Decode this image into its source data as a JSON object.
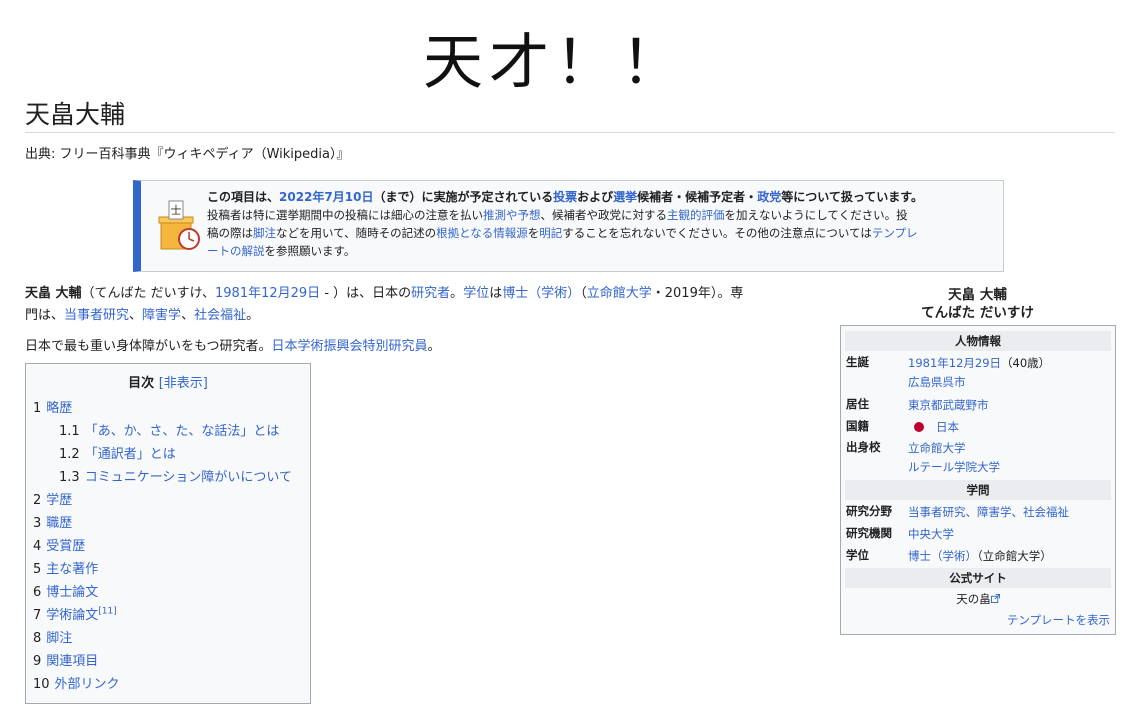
{
  "banner": "天才！！",
  "title": "天畠大輔",
  "from": "出典: フリー百科事典『ウィキペディア（Wikipedia）』",
  "notice": {
    "head_a": "この項目は、",
    "head_date": "2022年7月10日",
    "head_b": "（まで）に実施が予定されている",
    "head_vote": "投票",
    "head_c": "および",
    "head_elect": "選挙",
    "head_d": "候補者・候補予定者・",
    "head_party": "政党",
    "head_e": "等について扱っています。",
    "line1a": "投稿者は特に選挙期間中の投稿には細心の注意を払い",
    "line1_l1": "推測や予想",
    "line1b": "、候補者や政党に対する",
    "line1_l2": "主観的評価",
    "line1c": "を加えないようにしてください。投",
    "line2a": "稿の際は",
    "line2_l1": "脚注",
    "line2b": "などを用いて、随時その記述の",
    "line2_l2": "根拠となる情報源",
    "line2c": "を",
    "line2_l3": "明記",
    "line2d": "することを忘れないでください。その他の注意点については",
    "line2_l4": "テンプレ",
    "line3_l1": "ートの解説",
    "line3a": "を参照願います。"
  },
  "lead": {
    "name": "天畠 大輔",
    "a": "（てんばた だいすけ、",
    "birth": "1981年12月29日",
    "b": " - ）は、日本の",
    "researcher": "研究者",
    "c": "。",
    "degree": "学位",
    "d": "は",
    "phd": "博士（学術）",
    "e": "（",
    "uni": "立命館大学",
    "f": "・2019年）。専",
    "g": "門は、",
    "f1": "当事者研究",
    "h": "、",
    "f2": "障害学",
    "i": "、",
    "f3": "社会福祉",
    "j": "。"
  },
  "lead2": {
    "a": "日本で最も重い身体障がいをもつ研究者。",
    "jsps": "日本学術振興会特別研究員",
    "b": "。"
  },
  "toc": {
    "title": "目次",
    "hide": "[非表示]",
    "items": [
      {
        "num": "1",
        "label": "略歴"
      },
      {
        "num": "1.1",
        "label": "「あ、か、さ、た、な話法」とは"
      },
      {
        "num": "1.2",
        "label": "「通訳者」とは"
      },
      {
        "num": "1.3",
        "label": "コミュニケーション障がいについて"
      },
      {
        "num": "2",
        "label": "学歴"
      },
      {
        "num": "3",
        "label": "職歴"
      },
      {
        "num": "4",
        "label": "受賞歴"
      },
      {
        "num": "5",
        "label": "主な著作"
      },
      {
        "num": "6",
        "label": "博士論文"
      },
      {
        "num": "7",
        "label": "学術論文",
        "sup": "[11]"
      },
      {
        "num": "8",
        "label": "脚注"
      },
      {
        "num": "9",
        "label": "関連項目"
      },
      {
        "num": "10",
        "label": "外部リンク"
      }
    ]
  },
  "infobox": {
    "caption1": "天畠 大輔",
    "caption2": "てんばた だいすけ",
    "h_person": "人物情報",
    "birth_lbl": "生誕",
    "birth_date": "1981年12月29日",
    "birth_age": "（40歳）",
    "birth_place": "広島県呉市",
    "residence_lbl": "居住",
    "residence": "東京都武蔵野市",
    "nation_lbl": "国籍",
    "nation": "日本",
    "school_lbl": "出身校",
    "school1": "立命館大学",
    "school2": "ルテール学院大学",
    "h_study": "学問",
    "field_lbl": "研究分野",
    "field": "当事者研究、障害学、社会福祉",
    "inst_lbl": "研究機関",
    "inst": "中央大学",
    "deg_lbl": "学位",
    "deg": "博士（学術）",
    "deg_note": "（立命館大学）",
    "h_site": "公式サイト",
    "site": "天の畠",
    "template": "テンプレートを表示"
  }
}
